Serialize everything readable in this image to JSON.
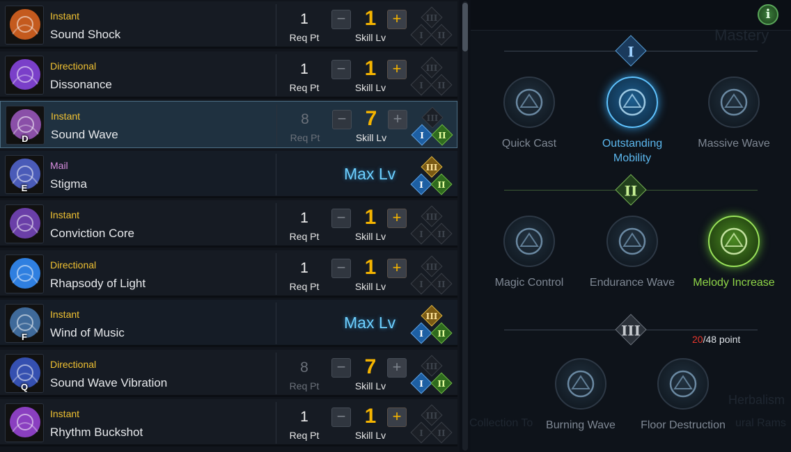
{
  "skills": [
    {
      "type": "Instant",
      "type_class": "t-instant",
      "name": "Sound Shock",
      "hotkey": "",
      "req_pt": "1",
      "req_lbl": "Req Pt",
      "lv": "1",
      "lv_lbl": "Skill Lv",
      "minus": "−",
      "plus": "+",
      "tripods": [
        "III",
        "I",
        "II"
      ],
      "state": "normal",
      "icon_color": "#c45a1e"
    },
    {
      "type": "Directional",
      "type_class": "t-directional",
      "name": "Dissonance",
      "hotkey": "",
      "req_pt": "1",
      "req_lbl": "Req Pt",
      "lv": "1",
      "lv_lbl": "Skill Lv",
      "minus": "−",
      "plus": "+",
      "tripods": [
        "III",
        "I",
        "II"
      ],
      "state": "normal",
      "icon_color": "#7a3fc9"
    },
    {
      "type": "Instant",
      "type_class": "t-instant",
      "name": "Sound Wave",
      "hotkey": "D",
      "req_pt": "8",
      "req_lbl": "Req Pt",
      "lv": "7",
      "lv_lbl": "Skill Lv",
      "minus": "−",
      "plus": "+",
      "tripods": [
        "III",
        "I",
        "II"
      ],
      "state": "selected",
      "icon_color": "#8a4fa8"
    },
    {
      "type": "Mail",
      "type_class": "t-mail",
      "name": "Stigma",
      "hotkey": "E",
      "max_label": "Max Lv",
      "tripods": [
        "III",
        "I",
        "II"
      ],
      "state": "maxed",
      "icon_color": "#4a5bb8"
    },
    {
      "type": "Instant",
      "type_class": "t-instant",
      "name": "Conviction Core",
      "hotkey": "",
      "req_pt": "1",
      "req_lbl": "Req Pt",
      "lv": "1",
      "lv_lbl": "Skill Lv",
      "minus": "−",
      "plus": "+",
      "tripods": [
        "III",
        "I",
        "II"
      ],
      "state": "normal",
      "icon_color": "#6a3fa8"
    },
    {
      "type": "Directional",
      "type_class": "t-directional",
      "name": "Rhapsody of Light",
      "hotkey": "",
      "req_pt": "1",
      "req_lbl": "Req Pt",
      "lv": "1",
      "lv_lbl": "Skill Lv",
      "minus": "−",
      "plus": "+",
      "tripods": [
        "III",
        "I",
        "II"
      ],
      "state": "normal",
      "icon_color": "#2f7fe0"
    },
    {
      "type": "Instant",
      "type_class": "t-instant",
      "name": "Wind of Music",
      "hotkey": "F",
      "max_label": "Max Lv",
      "tripods": [
        "III",
        "I",
        "II"
      ],
      "state": "maxed",
      "icon_color": "#3f6a9a"
    },
    {
      "type": "Directional",
      "type_class": "t-directional",
      "name": "Sound Wave Vibration",
      "hotkey": "Q",
      "req_pt": "8",
      "req_lbl": "Req Pt",
      "lv": "7",
      "lv_lbl": "Skill Lv",
      "minus": "−",
      "plus": "+",
      "tripods": [
        "III",
        "I",
        "II"
      ],
      "state": "leveled",
      "icon_color": "#3550b0"
    },
    {
      "type": "Instant",
      "type_class": "t-instant",
      "name": "Rhythm Buckshot",
      "hotkey": "",
      "req_pt": "1",
      "req_lbl": "Req Pt",
      "lv": "1",
      "lv_lbl": "Skill Lv",
      "minus": "−",
      "plus": "+",
      "tripods": [
        "III",
        "I",
        "II"
      ],
      "state": "normal",
      "icon_color": "#8a3fc0"
    }
  ],
  "tree": {
    "info_label": "i",
    "ghost_top": "Mastery",
    "ghost_bottom_right": "Herbalism",
    "ghost_bottom_left": "Collection To",
    "ghost_bottom_right2": "ural Rams",
    "tiers": [
      {
        "numeral": "I",
        "nodes": [
          {
            "name": "Quick Cast",
            "icon": "quick-cast-icon",
            "active": false
          },
          {
            "name": "Outstanding Mobility",
            "icon": "outstanding-mobility-icon",
            "active": true
          },
          {
            "name": "Massive Wave",
            "icon": "massive-wave-icon",
            "active": false
          }
        ]
      },
      {
        "numeral": "II",
        "nodes": [
          {
            "name": "Magic Control",
            "icon": "magic-control-icon",
            "active": false
          },
          {
            "name": "Endurance Wave",
            "icon": "endurance-wave-icon",
            "active": false
          },
          {
            "name": "Melody Increase",
            "icon": "melody-increase-icon",
            "active": true
          }
        ]
      },
      {
        "numeral": "III",
        "nodes": [
          {
            "name": "Burning Wave",
            "icon": "burning-wave-icon",
            "active": false
          },
          {
            "name": "Floor Destruction",
            "icon": "floor-destruction-icon",
            "active": false
          }
        ]
      }
    ],
    "points_used": "20",
    "points_total": "/48 point"
  },
  "colors": {
    "accent_gold": "#f5b400",
    "accent_blue": "#5cb8ef",
    "accent_green": "#8fd648",
    "points_red": "#e8372d"
  }
}
